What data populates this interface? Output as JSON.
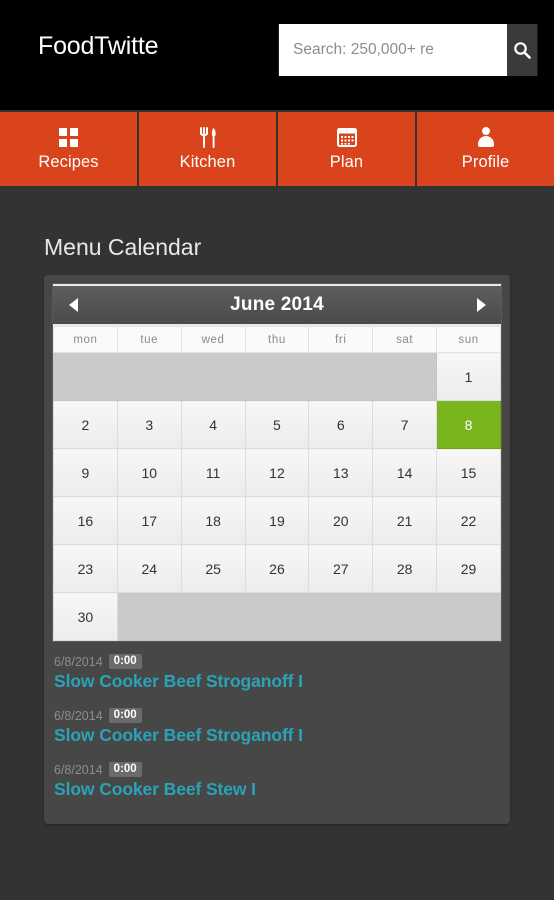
{
  "header": {
    "brand": "FoodTwitte",
    "search": {
      "placeholder": "Search: 250,000+ re",
      "value": "",
      "button_icon": "search-icon"
    }
  },
  "nav": {
    "items": [
      {
        "label": "Recipes",
        "icon": "grid-icon"
      },
      {
        "label": "Kitchen",
        "icon": "fork-knife-icon"
      },
      {
        "label": "Plan",
        "icon": "calendar-icon"
      },
      {
        "label": "Profile",
        "icon": "person-icon"
      }
    ],
    "accent_color": "#d9441c"
  },
  "main": {
    "page_title": "Menu Calendar",
    "calendar": {
      "month_label": "June 2014",
      "prev_label": "◀",
      "next_label": "▶",
      "weekdays": [
        "mon",
        "tue",
        "wed",
        "thu",
        "fri",
        "sat",
        "sun"
      ],
      "selected_day": 8,
      "selected_color": "#7ab51d",
      "weeks": [
        [
          "",
          "",
          "",
          "",
          "",
          "",
          "1"
        ],
        [
          "2",
          "3",
          "4",
          "5",
          "6",
          "7",
          "8"
        ],
        [
          "9",
          "10",
          "11",
          "12",
          "13",
          "14",
          "15"
        ],
        [
          "16",
          "17",
          "18",
          "19",
          "20",
          "21",
          "22"
        ],
        [
          "23",
          "24",
          "25",
          "26",
          "27",
          "28",
          "29"
        ],
        [
          "30",
          "",
          "",
          "",
          "",
          "",
          ""
        ]
      ]
    },
    "recipes": [
      {
        "date": "6/8/2014",
        "time": "0:00",
        "title": "Slow Cooker Beef Stroganoff I"
      },
      {
        "date": "6/8/2014",
        "time": "0:00",
        "title": "Slow Cooker Beef Stroganoff I"
      },
      {
        "date": "6/8/2014",
        "time": "0:00",
        "title": "Slow Cooker Beef Stew I"
      }
    ]
  }
}
